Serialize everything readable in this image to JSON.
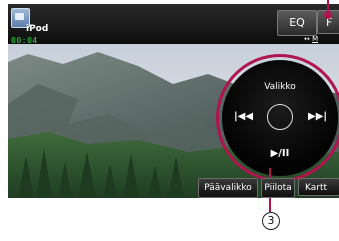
{
  "source": {
    "label": "iPod",
    "icon": "ipod-icon",
    "play_time": "00:04"
  },
  "top_buttons": {
    "eq": "EQ",
    "fs": "F"
  },
  "mode": {
    "arrow": "↔",
    "text": "M"
  },
  "circle_menu": {
    "title": "Valikko",
    "prev": "|◀◀",
    "next": "▶▶|",
    "play_pause": "▶/II"
  },
  "bottom_buttons": {
    "main_menu": "Päävalikko",
    "hide": "Piilota",
    "map": "Kartt"
  },
  "callout": {
    "number": "3"
  },
  "colors": {
    "accent": "#b0144e",
    "time_green": "#35e04a",
    "bar_bg": "#0d0d0d"
  }
}
